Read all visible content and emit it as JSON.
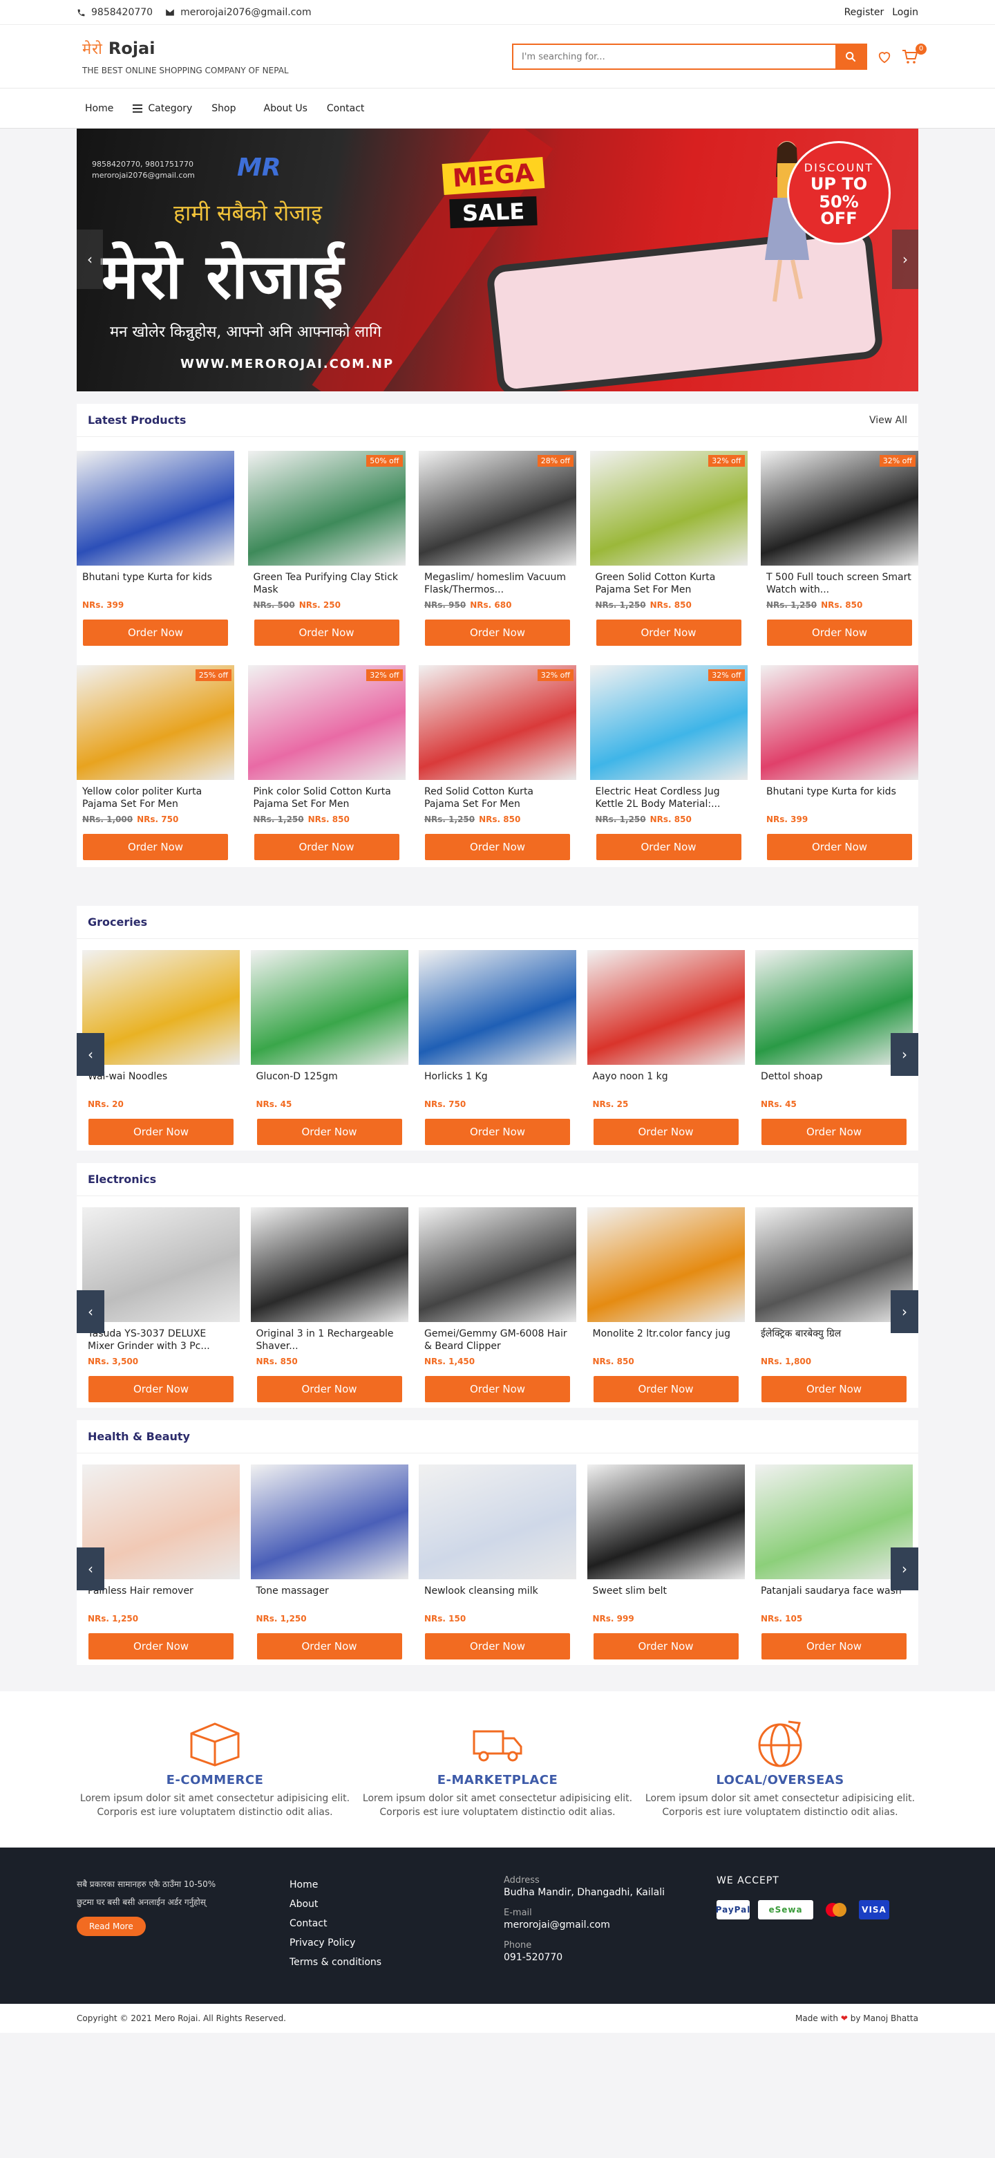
{
  "topbar": {
    "phone": "9858420770",
    "email": "merorojai2076@gmail.com",
    "register": "Register",
    "login": "Login"
  },
  "header": {
    "logo_devanagari": "मेरो",
    "brand": "Rojai",
    "tagline": "THE BEST ONLINE SHOPPING COMPANY OF NEPAL",
    "search_placeholder": "I'm searching for...",
    "cart_count": "0"
  },
  "nav": {
    "home": "Home",
    "category": "Category",
    "shop": "Shop",
    "about": "About Us",
    "contact": "Contact"
  },
  "banner": {
    "contact": "9858420770, 9801751770",
    "contact_email": "merorojai2076@gmail.com",
    "logo": "MR",
    "line1": "हामी सबैको रोजाइ",
    "headline": "मेरो रोजाई",
    "line2": "मन खोलेर किन्नुहोस, आफ्नो अनि आफ्नाको लागि",
    "url": "WWW.MEROROJAI.COM.NP",
    "mega": "MEGA",
    "sale": "SALE",
    "discount": "DISCOUNT",
    "upto": "UP TO",
    "percent": "50%",
    "off": "OFF"
  },
  "latest": {
    "title": "Latest Products",
    "view_all": "View All",
    "order_label": "Order Now",
    "row1": [
      {
        "name": "Bhutani type Kurta for kids",
        "old": "",
        "price": "NRs. 399",
        "off": "",
        "color": "#2c4fb8"
      },
      {
        "name": "Green Tea Purifying Clay Stick Mask",
        "old": "NRs. 500",
        "price": "NRs. 250",
        "off": "50% off",
        "color": "#3e8a5a"
      },
      {
        "name": "Megaslim/ homeslim Vacuum Flask/Thermos...",
        "old": "NRs. 950",
        "price": "NRs. 680",
        "off": "28% off",
        "color": "#3a3a3a"
      },
      {
        "name": "Green Solid Cotton Kurta Pajama Set For Men",
        "old": "NRs. 1,250",
        "price": "NRs. 850",
        "off": "32% off",
        "color": "#9bb83a"
      },
      {
        "name": "T 500 Full touch screen Smart Watch with...",
        "old": "NRs. 1,250",
        "price": "NRs. 850",
        "off": "32% off",
        "color": "#222"
      }
    ],
    "row2": [
      {
        "name": "Yellow color politer Kurta Pajama Set For Men",
        "old": "NRs. 1,000",
        "price": "NRs. 750",
        "off": "25% off",
        "color": "#e8a31f"
      },
      {
        "name": "Pink color Solid Cotton Kurta Pajama Set For Men",
        "old": "NRs. 1,250",
        "price": "NRs. 850",
        "off": "32% off",
        "color": "#e96aa5"
      },
      {
        "name": "Red Solid Cotton Kurta Pajama Set For Men",
        "old": "NRs. 1,250",
        "price": "NRs. 850",
        "off": "32% off",
        "color": "#d93a3a"
      },
      {
        "name": "Electric Heat Cordless Jug Kettle 2L Body Material:...",
        "old": "NRs. 1,250",
        "price": "NRs. 850",
        "off": "32% off",
        "color": "#3fb5e8"
      },
      {
        "name": "Bhutani type Kurta for kids",
        "old": "",
        "price": "NRs. 399",
        "off": "",
        "color": "#e0406a"
      }
    ]
  },
  "groceries": {
    "title": "Groceries",
    "items": [
      {
        "name": "Wai-wai Noodles",
        "price": "NRs. 20",
        "color": "#e9b224"
      },
      {
        "name": "Glucon-D 125gm",
        "price": "NRs. 45",
        "color": "#3aa64a"
      },
      {
        "name": "Horlicks 1 Kg",
        "price": "NRs. 750",
        "color": "#1f5fb5"
      },
      {
        "name": "Aayo noon 1 kg",
        "price": "NRs. 25",
        "color": "#d9342b"
      },
      {
        "name": "Dettol shoap",
        "price": "NRs. 45",
        "color": "#2a9a46"
      }
    ]
  },
  "electronics": {
    "title": "Electronics",
    "items": [
      {
        "name": "Yasuda YS-3037 DELUXE Mixer Grinder with 3 Pc...",
        "price": "NRs. 3,500",
        "color": "#bdbdbd"
      },
      {
        "name": "Original 3 in 1 Rechargeable Shaver...",
        "price": "NRs. 850",
        "color": "#2a2a2a"
      },
      {
        "name": "Gemei/Gemmy GM-6008 Hair & Beard Clipper",
        "price": "NRs. 1,450",
        "color": "#444"
      },
      {
        "name": "Monolite 2 ltr.color fancy jug",
        "price": "NRs. 850",
        "color": "#e58b12"
      },
      {
        "name": "ईलेक्ट्रिक बारबेक्यु ग्रिल",
        "price": "NRs. 1,800",
        "color": "#555"
      }
    ]
  },
  "health": {
    "title": "Health & Beauty",
    "items": [
      {
        "name": "Painless Hair remover",
        "price": "NRs. 1,250",
        "color": "#f1c9b5"
      },
      {
        "name": "Tone massager",
        "price": "NRs. 1,250",
        "color": "#4a5fb8"
      },
      {
        "name": "Newlook cleansing milk",
        "price": "NRs. 150",
        "color": "#cfd8e8"
      },
      {
        "name": "Sweet slim belt",
        "price": "NRs. 999",
        "color": "#1f1f1f"
      },
      {
        "name": "Patanjali saudarya face wash",
        "price": "NRs. 105",
        "color": "#8ccf7a"
      }
    ]
  },
  "features": [
    {
      "title": "E-COMMERCE",
      "desc": "Lorem ipsum dolor sit amet consectetur adipisicing elit. Corporis est iure voluptatem distinctio odit alias."
    },
    {
      "title": "E-MARKETPLACE",
      "desc": "Lorem ipsum dolor sit amet consectetur adipisicing elit. Corporis est iure voluptatem distinctio odit alias."
    },
    {
      "title": "LOCAL/OVERSEAS",
      "desc": "Lorem ipsum dolor sit amet consectetur adipisicing elit. Corporis est iure voluptatem distinctio odit alias."
    }
  ],
  "footer": {
    "about_line1": "सबै प्रकारका सामानहरु एकै ठाउँमा 10-50%",
    "about_line2": "छुटमा घर बसी बसी अनलाईन अर्डर गर्नुहोस्",
    "read_more": "Read More",
    "links": [
      "Home",
      "About",
      "Contact",
      "Privacy Policy",
      "Terms & conditions"
    ],
    "address_label": "Address",
    "address": "Budha Mandir, Dhangadhi, Kailali",
    "email_label": "E-mail",
    "email": "merorojai@gmail.com",
    "phone_label": "Phone",
    "phone": "091-520770",
    "accept": "WE ACCEPT",
    "pay": [
      "PayPal",
      "eSewa",
      "mc",
      "VISA"
    ],
    "copyright": "Copyright © 2021 Mero Rojai. All Rights Reserved.",
    "made_with": "Made with",
    "made_by": "by Manoj Bhatta"
  }
}
